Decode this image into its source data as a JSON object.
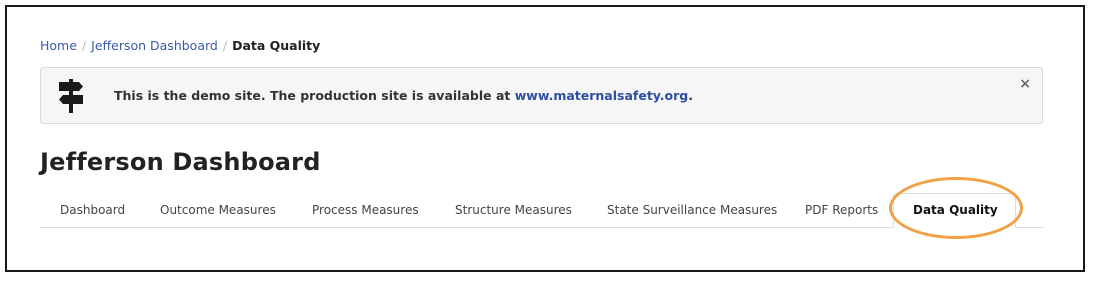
{
  "breadcrumb": {
    "items": [
      "Home",
      "Jefferson Dashboard"
    ],
    "separator": "/",
    "current": "Data Quality"
  },
  "alert": {
    "icon": "signpost-icon",
    "message": "This is the demo site. The production site is available at",
    "link_text": "www.maternalsafety.org",
    "trailing": ".",
    "close_label": "×"
  },
  "page": {
    "title": "Jefferson Dashboard"
  },
  "tabs": [
    {
      "label": "Dashboard",
      "active": false
    },
    {
      "label": "Outcome Measures",
      "active": false
    },
    {
      "label": "Process Measures",
      "active": false
    },
    {
      "label": "Structure Measures",
      "active": false
    },
    {
      "label": "State Surveillance Measures",
      "active": false
    },
    {
      "label": "PDF Reports",
      "active": false
    },
    {
      "label": "Data Quality",
      "active": true
    }
  ],
  "colors": {
    "link": "#3b5ba5",
    "annotation_circle": "#f0a045",
    "alert_bg": "#f6f6f6"
  }
}
